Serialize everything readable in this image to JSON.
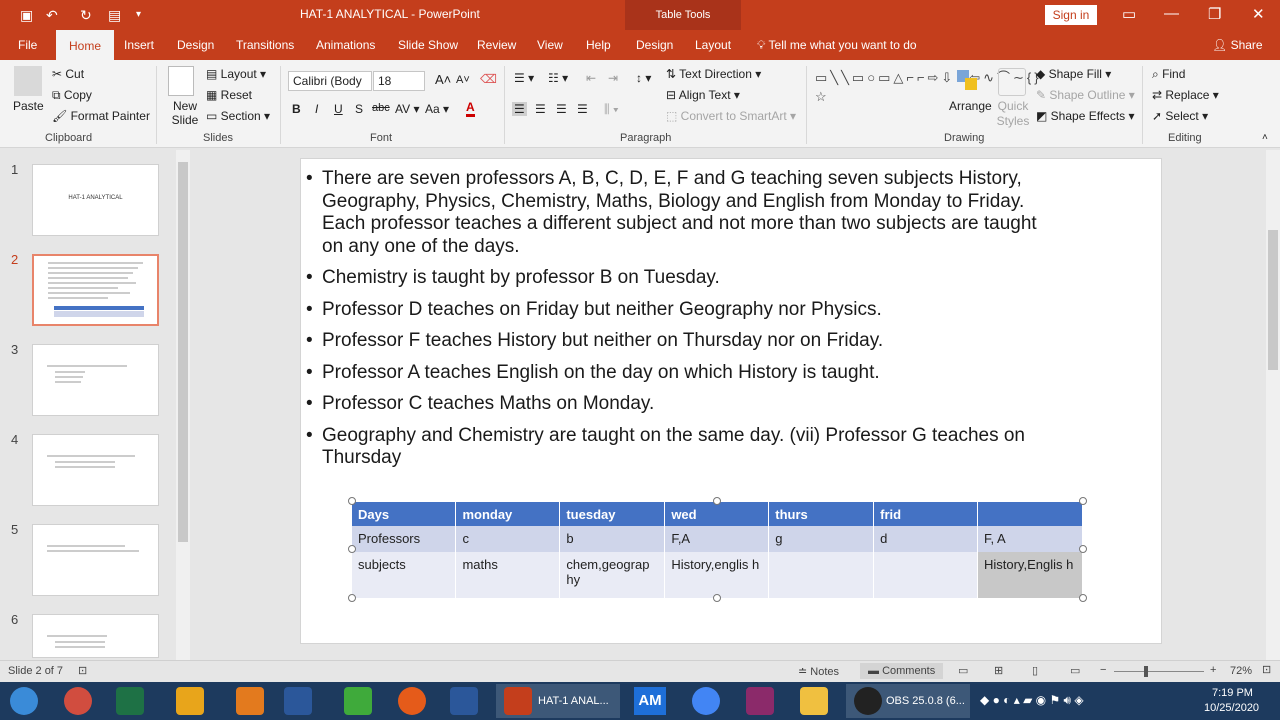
{
  "window": {
    "title": "HAT-1 ANALYTICAL  -  PowerPoint",
    "table_tools": "Table Tools",
    "sign_in": "Sign in"
  },
  "tabs": [
    "File",
    "Home",
    "Insert",
    "Design",
    "Transitions",
    "Animations",
    "Slide Show",
    "Review",
    "View",
    "Help",
    "Design",
    "Layout"
  ],
  "tell_me": "Tell me what you want to do",
  "share": "Share",
  "ribbon": {
    "clipboard": {
      "paste": "Paste",
      "cut": "Cut",
      "copy": "Copy",
      "format_painter": "Format Painter",
      "label": "Clipboard"
    },
    "slides": {
      "new_slide": "New Slide",
      "layout": "Layout",
      "reset": "Reset",
      "section": "Section",
      "label": "Slides"
    },
    "font": {
      "name": "Calibri (Body",
      "size": "18",
      "label": "Font"
    },
    "paragraph": {
      "text_direction": "Text Direction",
      "align_text": "Align Text",
      "convert_smartart": "Convert to SmartArt",
      "label": "Paragraph"
    },
    "drawing": {
      "arrange": "Arrange",
      "quick_styles": "Quick Styles",
      "shape_fill": "Shape Fill",
      "shape_outline": "Shape Outline",
      "shape_effects": "Shape Effects",
      "label": "Drawing"
    },
    "editing": {
      "find": "Find",
      "replace": "Replace",
      "select": "Select",
      "label": "Editing"
    }
  },
  "thumbnails": [
    {
      "num": "1",
      "title": "HAT-1 ANALYTICAL"
    },
    {
      "num": "2",
      "title": ""
    },
    {
      "num": "3",
      "title": ""
    },
    {
      "num": "4",
      "title": ""
    },
    {
      "num": "5",
      "title": ""
    },
    {
      "num": "6",
      "title": ""
    }
  ],
  "slide": {
    "bullets": [
      "There are seven professors A, B, C, D, E, F and G teaching seven subjects History, Geography, Physics, Chemistry, Maths, Biology and English from Monday to Friday. Each professor teaches a different subject and not more than two subjects are taught on any one of the days.",
      "Chemistry is taught by professor B on Tuesday.",
      "Professor D teaches on Friday but neither Geography nor Physics.",
      "Professor F teaches History but neither on Thursday nor on Friday.",
      "Professor A teaches English on the day on which History is taught.",
      "Professor C teaches Maths on Monday.",
      "Geography and Chemistry are taught on the same day. (vii) Professor G teaches on Thursday"
    ],
    "table": {
      "header": [
        "Days",
        "monday",
        "tuesday",
        "wed",
        "thurs",
        "frid",
        ""
      ],
      "rows": [
        [
          "Professors",
          "c",
          "b",
          "F,A",
          "g",
          "d",
          "F, A"
        ],
        [
          "subjects",
          "maths",
          "chem,geograp hy",
          "History,englis h",
          "",
          "",
          "History,Englis h"
        ]
      ]
    }
  },
  "status": {
    "slide_info": "Slide 2 of 7",
    "notes": "Notes",
    "comments": "Comments",
    "zoom": "72%"
  },
  "taskbar": {
    "ppt_label": "HAT-1 ANAL...",
    "am_label": "AM",
    "obs_label": "OBS 25.0.8 (6...",
    "time": "7:19 PM",
    "date": "10/25/2020"
  }
}
